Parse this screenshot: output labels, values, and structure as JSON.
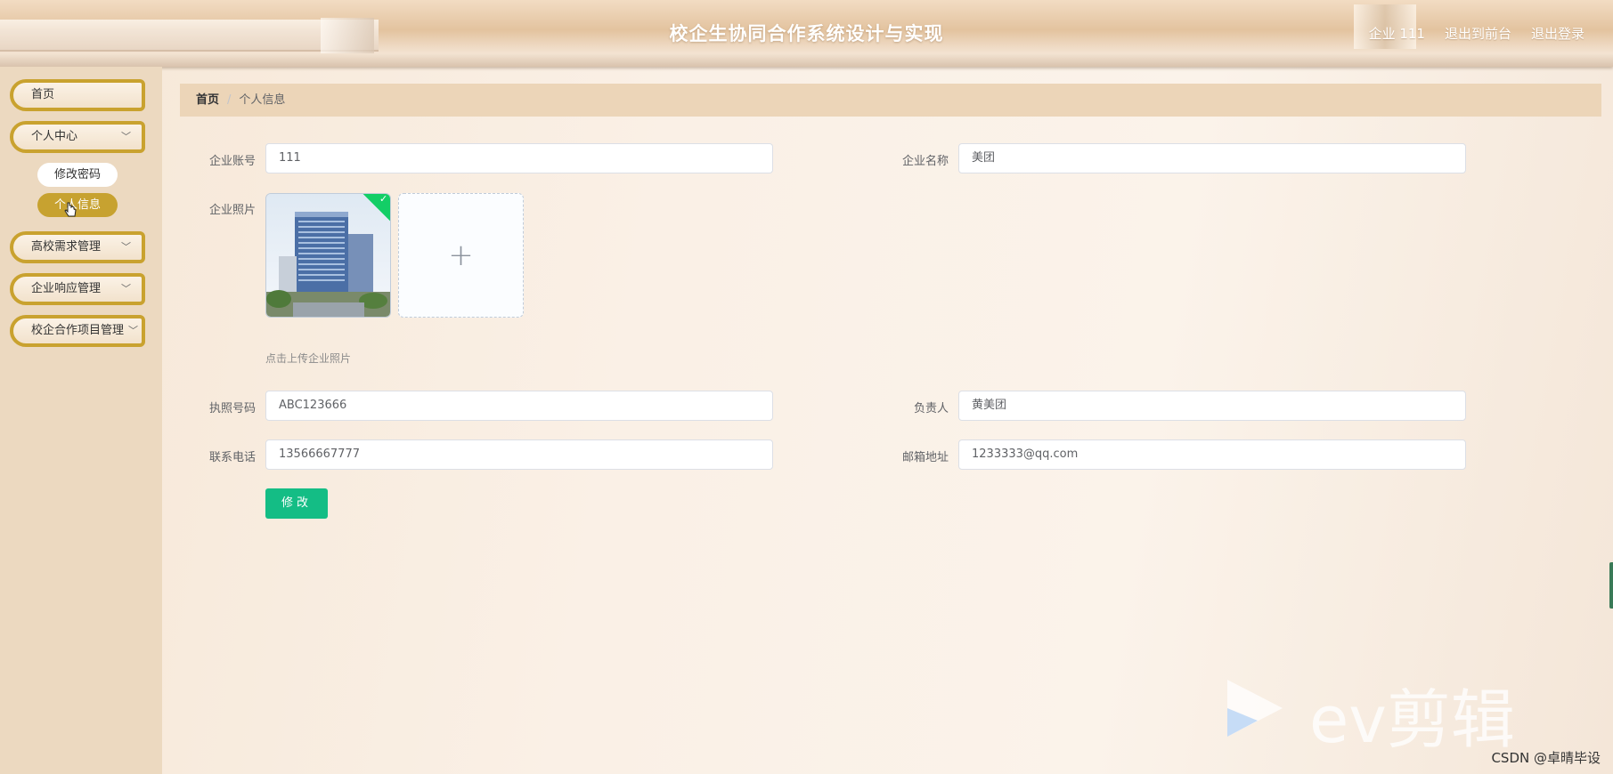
{
  "header": {
    "title": "校企生协同合作系统设计与实现",
    "user_label": "企业 111",
    "back_to_front": "退出到前台",
    "logout": "退出登录"
  },
  "sidebar": {
    "items": [
      {
        "label": "首页"
      },
      {
        "label": "个人中心",
        "chevron": "﹀"
      },
      {
        "label": "高校需求管理",
        "chevron": "﹀"
      },
      {
        "label": "企业响应管理",
        "chevron": "﹀"
      },
      {
        "label": "校企合作项目管理",
        "chevron": "﹀"
      }
    ],
    "sub_items": [
      {
        "label": "修改密码"
      },
      {
        "label": "个人信息"
      }
    ]
  },
  "breadcrumb": {
    "home": "首页",
    "separator": "/",
    "current": "个人信息"
  },
  "form": {
    "account_label": "企业账号",
    "account_value": "111",
    "name_label": "企业名称",
    "name_value": "美团",
    "photo_label": "企业照片",
    "upload_plus": "+",
    "upload_tip": "点击上传企业照片",
    "license_label": "执照号码",
    "license_value": "ABC123666",
    "owner_label": "负责人",
    "owner_value": "黄美团",
    "phone_label": "联系电话",
    "phone_value": "13566667777",
    "email_label": "邮箱地址",
    "email_value": "1233333@qq.com",
    "submit_label": "修改"
  },
  "watermark": {
    "text": "ev剪辑",
    "credit": "CSDN @卓晴毕设"
  },
  "colors": {
    "accent": "#c9a22f",
    "submit": "#14bd85",
    "breadcrumb_bg": "#ecd5b8"
  }
}
